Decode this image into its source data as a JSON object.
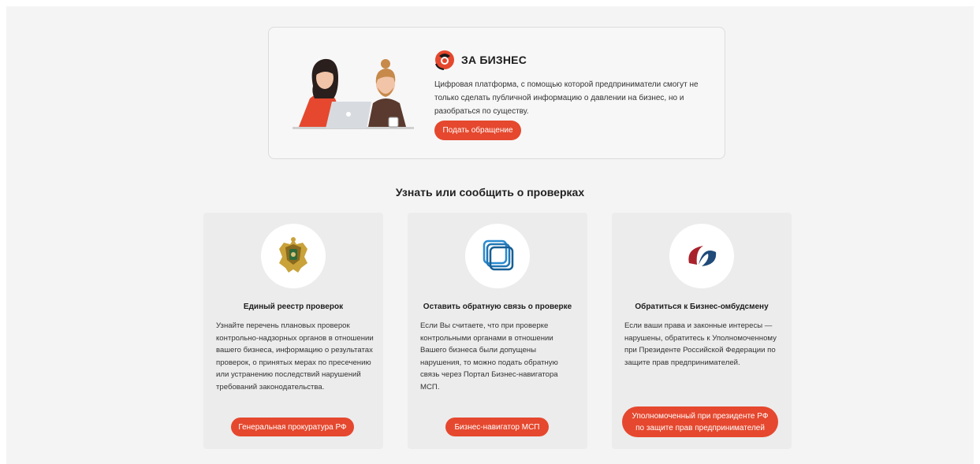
{
  "banner": {
    "brand": "ЗА БИЗНЕС",
    "description": "Цифровая платформа, с помощью которой предприниматели смогут не только сделать публичной информацию о давлении на бизнес, но и разобраться по существу.",
    "button": "Подать обращение"
  },
  "section": {
    "title": "Узнать или сообщить о проверках"
  },
  "cards": [
    {
      "title": "Единый реестр проверок",
      "text": "Узнайте перечень плановых проверок контрольно-надзорных органов в отношении вашего бизнеса, информацию о результатах проверок, о принятых мерах по пресечению или устранению последствий нарушений требований законодательства.",
      "button": "Генеральная прокуратура РФ"
    },
    {
      "title": "Оставить обратную связь о проверке",
      "text": "Если Вы считаете, что при проверке контрольными органами в отношении Вашего бизнеса были допущены нарушения, то можно подать обратную связь через Портал Бизнес-навигатора МСП.",
      "button": "Бизнес-навигатор МСП"
    },
    {
      "title": "Обратиться к Бизнес-омбудсмену",
      "text": "Если ваши права и законные интересы — нарушены, обратитесь к Уполномоченному при Президенте Российской Федерации по защите прав предпринимателей.",
      "button": "Уполномоченный при президенте РФ по защите прав предпринимателей"
    }
  ],
  "colors": {
    "accent": "#e5482e",
    "page_bg": "#f4f4f4",
    "card_bg": "#ececec"
  },
  "icons": [
    "za-biznes-logo-icon",
    "prosecutor-emblem-icon",
    "msp-navigator-icon",
    "ombudsman-logo-icon"
  ]
}
